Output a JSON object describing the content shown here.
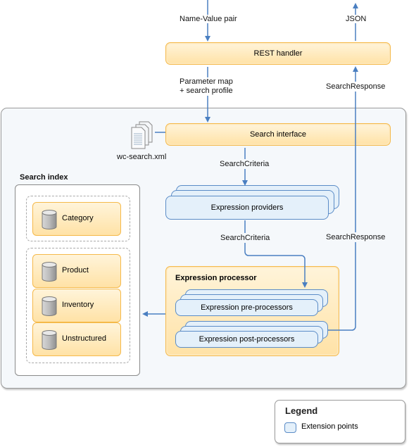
{
  "diagram": {
    "top_labels": {
      "input": "Name-Value pair",
      "output": "JSON",
      "param_map_line1": "Parameter map",
      "param_map_line2": "+ search profile",
      "search_response_top": "SearchResponse",
      "search_criteria_1": "SearchCriteria",
      "search_criteria_2": "SearchCriteria",
      "search_response_mid": "SearchResponse"
    },
    "nodes": {
      "rest_handler": "REST handler",
      "search_interface": "Search interface",
      "config_file": "wc-search.xml",
      "expression_providers": "Expression providers",
      "expression_processor": "Expression processor",
      "pre_processors": "Expression pre-processors",
      "post_processors": "Expression post-processors"
    },
    "search_index": {
      "title": "Search index",
      "groups": [
        {
          "items": [
            "Category"
          ]
        },
        {
          "items": [
            "Product",
            "Inventory",
            "Unstructured"
          ]
        }
      ]
    },
    "legend": {
      "title": "Legend",
      "items": [
        {
          "label": "Extension points",
          "color": "#e4f0fa"
        }
      ]
    },
    "colors": {
      "arrow": "#4a7fc1",
      "component_border": "#f5b94a",
      "extension_fill": "#e4f0fa",
      "extension_border": "#5b8cc7"
    }
  }
}
